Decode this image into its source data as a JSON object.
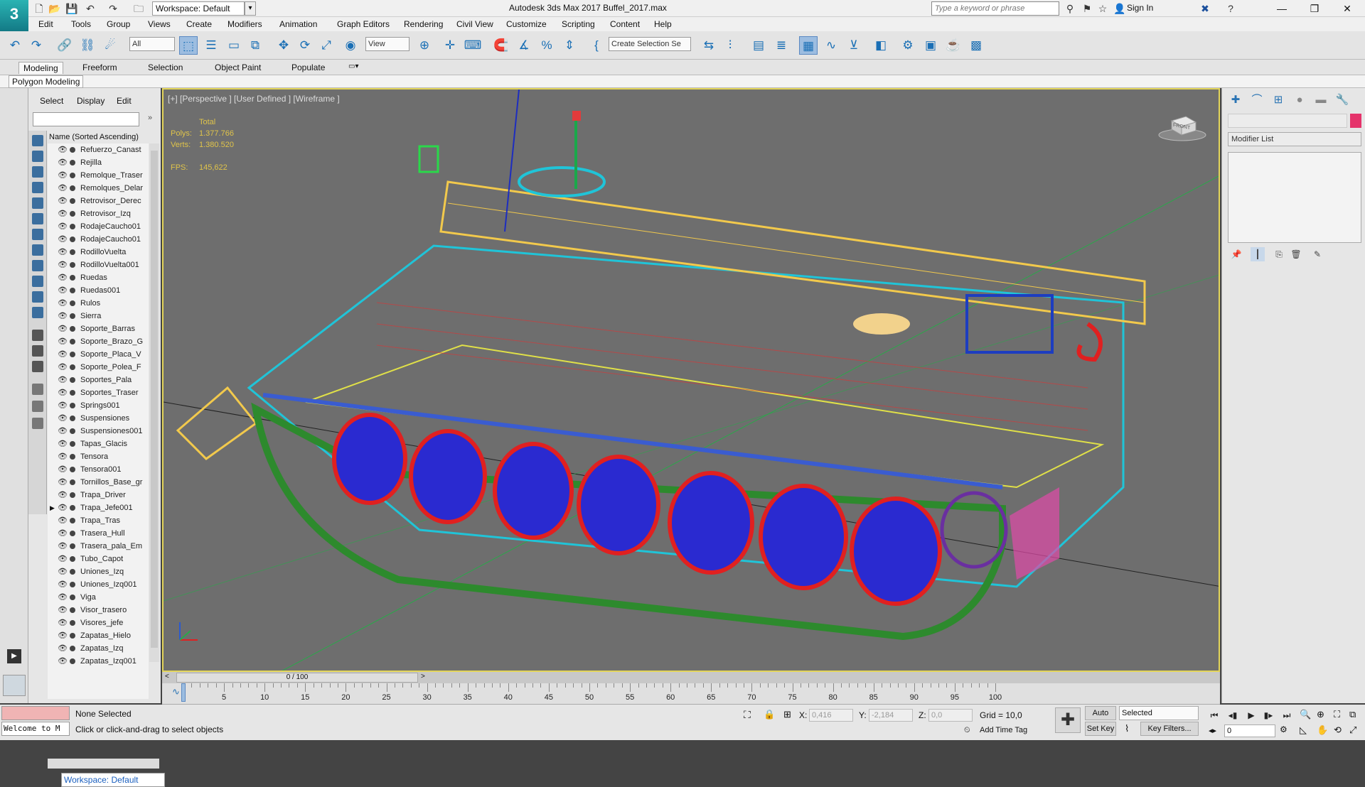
{
  "app": {
    "logo": "3",
    "title": "Autodesk 3ds Max 2017    Buffel_2017.max",
    "workspace": "Workspace: Default",
    "search_placeholder": "Type a keyword or phrase",
    "sign_in": "Sign In"
  },
  "menu": [
    "Edit",
    "Tools",
    "Group",
    "Views",
    "Create",
    "Modifiers",
    "Animation",
    "Graph Editors",
    "Rendering",
    "Civil View",
    "Customize",
    "Scripting",
    "Content",
    "Help"
  ],
  "toolbar": {
    "selection_filter": "All",
    "ref_coord": "View",
    "named_selection": "Create Selection Se"
  },
  "ribbon": {
    "tabs": [
      "Modeling",
      "Freeform",
      "Selection",
      "Object Paint",
      "Populate"
    ],
    "active_tab": "Modeling",
    "sub_label": "Polygon Modeling"
  },
  "explorer": {
    "tabs": [
      "Select",
      "Display",
      "Edit"
    ],
    "header": "Name (Sorted Ascending)",
    "items": [
      "Refuerzo_Canast",
      "Rejilla",
      "Remolque_Traser",
      "Remolques_Delar",
      "Retrovisor_Derec",
      "Retrovisor_Izq",
      "RodajeCaucho01",
      "RodajeCaucho01",
      "RodilloVuelta",
      "RodilloVuelta001",
      "Ruedas",
      "Ruedas001",
      "Rulos",
      "Sierra",
      "Soporte_Barras",
      "Soporte_Brazo_G",
      "Soporte_Placa_V",
      "Soporte_Polea_F",
      "Soportes_Pala",
      "Soportes_Traser",
      "Springs001",
      "Suspensiones",
      "Suspensiones001",
      "Tapas_Glacis",
      "Tensora",
      "Tensora001",
      "Tornillos_Base_gr",
      "Trapa_Driver",
      "Trapa_Jefe001",
      "Trapa_Tras",
      "Trasera_Hull",
      "Trasera_pala_Em",
      "Tubo_Capot",
      "Uniones_Izq",
      "Uniones_Izq001",
      "Viga",
      "Visor_trasero",
      "Visores_jefe",
      "Zapatas_Hielo",
      "Zapatas_Izq",
      "Zapatas_Izq001"
    ],
    "expanded_item": "Trapa_Jefe001",
    "workspace_bottom": "Workspace: Default"
  },
  "viewport": {
    "label": "[+] [Perspective ] [User Defined ] [Wireframe ]",
    "stats": {
      "total_label": "Total",
      "polys_label": "Polys:",
      "polys": "1.377.766",
      "verts_label": "Verts:",
      "verts": "1.380.520",
      "fps_label": "FPS:",
      "fps": "145,622"
    },
    "viewcube_label": "FRONT"
  },
  "command_panel": {
    "modifier_list": "Modifier List",
    "object_color": "#e5336b"
  },
  "timeline": {
    "slider": "0 / 100",
    "ticks": [
      "5",
      "10",
      "15",
      "20",
      "25",
      "30",
      "35",
      "40",
      "45",
      "50",
      "55",
      "60",
      "65",
      "70",
      "75",
      "80",
      "85",
      "90",
      "95",
      "100"
    ]
  },
  "status": {
    "welcome": "Welcome to M",
    "selection": "None Selected",
    "prompt": "Click or click-and-drag to select objects",
    "x_label": "X:",
    "x": "0,416",
    "y_label": "Y:",
    "y": "-2,184",
    "z_label": "Z:",
    "z": "0,0",
    "grid": "Grid = 10,0",
    "add_time_tag": "Add Time Tag",
    "auto_key": "Auto Key",
    "set_key": "Set Key",
    "selected": "Selected",
    "key_filters": "Key Filters...",
    "frame": "0"
  }
}
